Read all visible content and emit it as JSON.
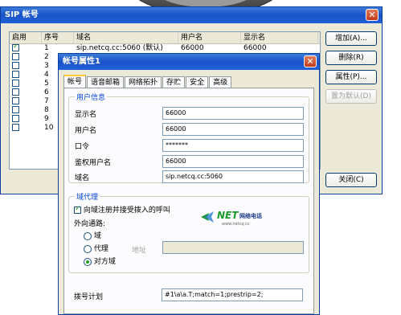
{
  "main_window": {
    "title": "SIP 帐号",
    "columns": [
      "启用",
      "序号",
      "域名",
      "用户名",
      "显示名"
    ],
    "rows": [
      {
        "enabled": true,
        "index": "1",
        "domain": "sip.netcq.cc:5060 (默认)",
        "username": "66000",
        "display": "66000"
      },
      {
        "enabled": false,
        "index": "2",
        "domain": "",
        "username": "",
        "display": ""
      },
      {
        "enabled": false,
        "index": "3",
        "domain": "",
        "username": "",
        "display": ""
      },
      {
        "enabled": false,
        "index": "4",
        "domain": "",
        "username": "",
        "display": ""
      },
      {
        "enabled": false,
        "index": "5",
        "domain": "",
        "username": "",
        "display": ""
      },
      {
        "enabled": false,
        "index": "6",
        "domain": "",
        "username": "",
        "display": ""
      },
      {
        "enabled": false,
        "index": "7",
        "domain": "",
        "username": "",
        "display": ""
      },
      {
        "enabled": false,
        "index": "8",
        "domain": "",
        "username": "",
        "display": ""
      },
      {
        "enabled": false,
        "index": "9",
        "domain": "",
        "username": "",
        "display": ""
      },
      {
        "enabled": false,
        "index": "10",
        "domain": "",
        "username": "",
        "display": ""
      }
    ],
    "buttons": {
      "add": "增加(A)...",
      "delete": "删除(R)",
      "properties": "属性(P)...",
      "set_default": "置为默认(D)",
      "close": "关闭(C)"
    }
  },
  "dialog": {
    "title": "帐号属性1",
    "tabs": [
      "帐号",
      "语音邮箱",
      "网络拓扑",
      "存贮",
      "安全",
      "高级"
    ],
    "user_info": {
      "title": "用户信息",
      "display_name_label": "显示名",
      "display_name": "66000",
      "username_label": "用户名",
      "username": "66000",
      "password_label": "口令",
      "password": "*******",
      "auth_user_label": "鉴权用户名",
      "auth_user": "66000",
      "domain_label": "域名",
      "domain": "sip.netcq.cc:5060"
    },
    "proxy": {
      "title": "域代理",
      "register_label": "向域注册并接受拨入的呼叫",
      "register_checked": true,
      "outbound_label": "外向通路:",
      "opt_domain": "域",
      "opt_proxy": "代理",
      "address_label": "地址",
      "opt_peer": "对方域",
      "selected": "opt_peer"
    },
    "dial_plan_label": "拨号计划",
    "dial_plan": "#1\\a\\a.T;match=1;prestrip=2;",
    "logo_text": "NET",
    "logo_subtext": "www.netcq.cc"
  },
  "colors": {
    "title_blue": "#1a53c9",
    "group_title": "#0046d5",
    "tab_highlight": "#ffc83c",
    "close_red": "#c63a1c"
  }
}
